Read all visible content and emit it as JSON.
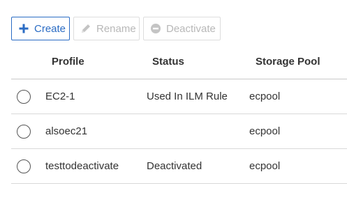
{
  "toolbar": {
    "create_label": "Create",
    "rename_label": "Rename",
    "deactivate_label": "Deactivate"
  },
  "table": {
    "columns": [
      "Profile",
      "Status",
      "Storage Pool"
    ],
    "rows": [
      {
        "profile": "EC2-1",
        "status": "Used In ILM Rule",
        "pool": "ecpool"
      },
      {
        "profile": "alsoec21",
        "status": "",
        "pool": "ecpool"
      },
      {
        "profile": "testtodeactivate",
        "status": "Deactivated",
        "pool": "ecpool"
      }
    ]
  },
  "colors": {
    "primary": "#2b6cc4",
    "disabled": "#b8b8b8",
    "divider": "#d9d9d9"
  },
  "icons": {
    "create": "plus-icon",
    "rename": "pencil-icon",
    "deactivate": "minus-circle-icon",
    "row_select": "radio-button"
  }
}
